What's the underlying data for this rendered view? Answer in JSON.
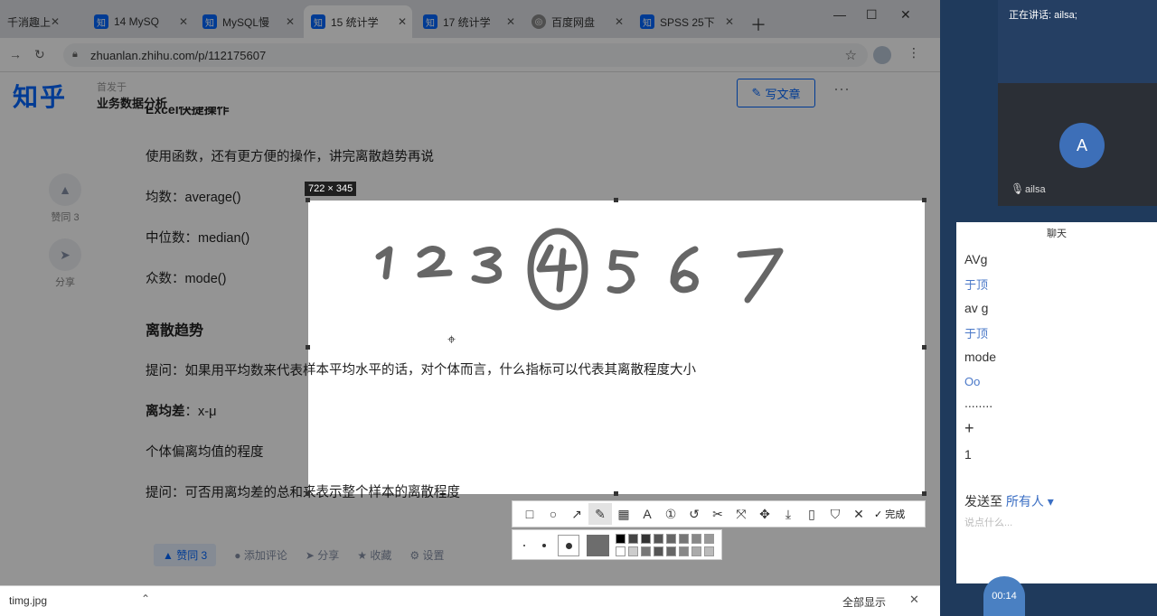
{
  "browser": {
    "tabs": [
      {
        "label": "千消趣上",
        "icon": "none"
      },
      {
        "label": "14 MySQ",
        "icon": "知"
      },
      {
        "label": "MySQL慢",
        "icon": "知"
      },
      {
        "label": "15 统计学",
        "icon": "知"
      },
      {
        "label": "17 统计学",
        "icon": "知"
      },
      {
        "label": "百度网盘",
        "icon": "grey"
      },
      {
        "label": "SPSS 25下",
        "icon": "知"
      }
    ],
    "url": "zhuanlan.zhihu.com/p/112175607"
  },
  "page": {
    "logo": "知乎",
    "column_small": "首发于",
    "column_title": "业务数据分析",
    "write_button": "写文章",
    "cut_heading": "Excel快捷操作",
    "paragraphs": {
      "p1": "使用函数，还有更方便的操作，讲完离散趋势再说",
      "p2": "均数：average()",
      "p3": "中位数：median()",
      "p4": "众数：mode()",
      "h_dispersion": "离散趋势",
      "p5": "提问：如果用平均数来代表样本平均水平的话，对个体而言，什么指标可以代表其离散程度大小",
      "p6_label": "离均差",
      "p6_value": "：x-μ",
      "p7": "个体偏离均值的程度",
      "p8": "提问：可否用离均差的总和来表示整个样本的离散程度"
    },
    "side_like": "赞同 3",
    "side_share": "分享",
    "bottom": {
      "vote": "▲ 赞同 3",
      "comment": "添加评论",
      "share": "分享",
      "fav": "收藏",
      "settings": "设置"
    }
  },
  "download": {
    "file": "timg.jpg",
    "show_all": "全部显示"
  },
  "screenshot": {
    "size_label": "722 × 345",
    "done": "完成"
  },
  "meeting": {
    "speaking": "正在讲话: ailsa;",
    "avatar_letter": "A",
    "video_name": "ailsa",
    "chat_title": "聊天",
    "messages": [
      {
        "text": "AVg",
        "sub": "于顶"
      },
      {
        "text": "av g",
        "sub": "于顶"
      },
      {
        "text": "mode",
        "sub": "Oo"
      },
      {
        "text": "........",
        "sub": ""
      },
      {
        "text": "+",
        "sub": ""
      },
      {
        "text": "1",
        "sub": ""
      }
    ],
    "send_to_label": "发送至",
    "send_to_value": "所有人",
    "input_hint": "说点什么..."
  },
  "colors": {
    "zhihu_blue": "#0066ff",
    "meeting_bg": "#1f3a5c"
  }
}
